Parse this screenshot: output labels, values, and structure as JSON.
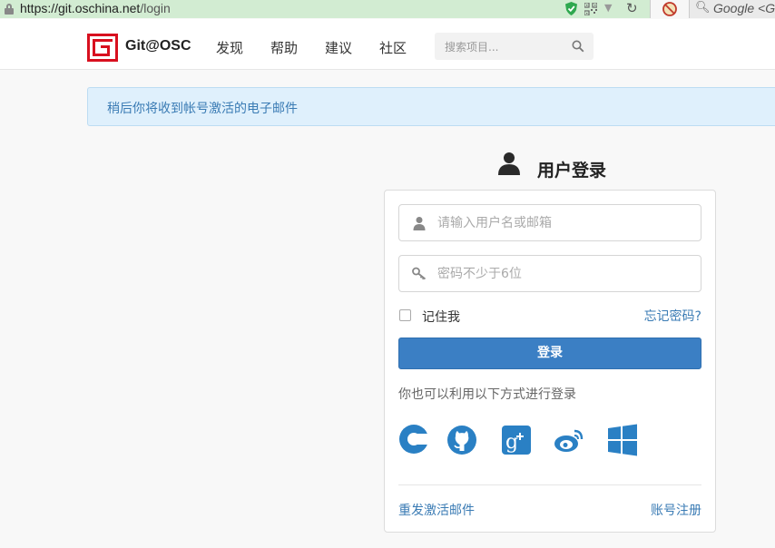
{
  "browser": {
    "url_host": "https://git.oschina.net",
    "url_path": "/login",
    "search_placeholder": "Google <G"
  },
  "nav": {
    "logo_text": "Git@OSC",
    "items": [
      "发现",
      "帮助",
      "建议",
      "社区"
    ],
    "search_placeholder": "搜索项目..."
  },
  "alert": {
    "text": "稍后你将收到帐号激活的电子邮件"
  },
  "login": {
    "title": "用户登录",
    "username_placeholder": "请输入用户名或邮箱",
    "password_placeholder": "密码不少于6位",
    "remember_label": "记住我",
    "forgot_label": "忘记密码?",
    "submit_label": "登录",
    "alt_login_text": "你也可以利用以下方式进行登录",
    "social_providers": [
      "csdn",
      "github",
      "google-plus",
      "weibo",
      "windows"
    ],
    "resend_label": "重发激活邮件",
    "register_label": "账号注册"
  },
  "colors": {
    "brand_red": "#d8101f",
    "link_blue": "#3a7bb4",
    "button_blue": "#3b7fc4",
    "alert_bg": "#dff0fc"
  }
}
